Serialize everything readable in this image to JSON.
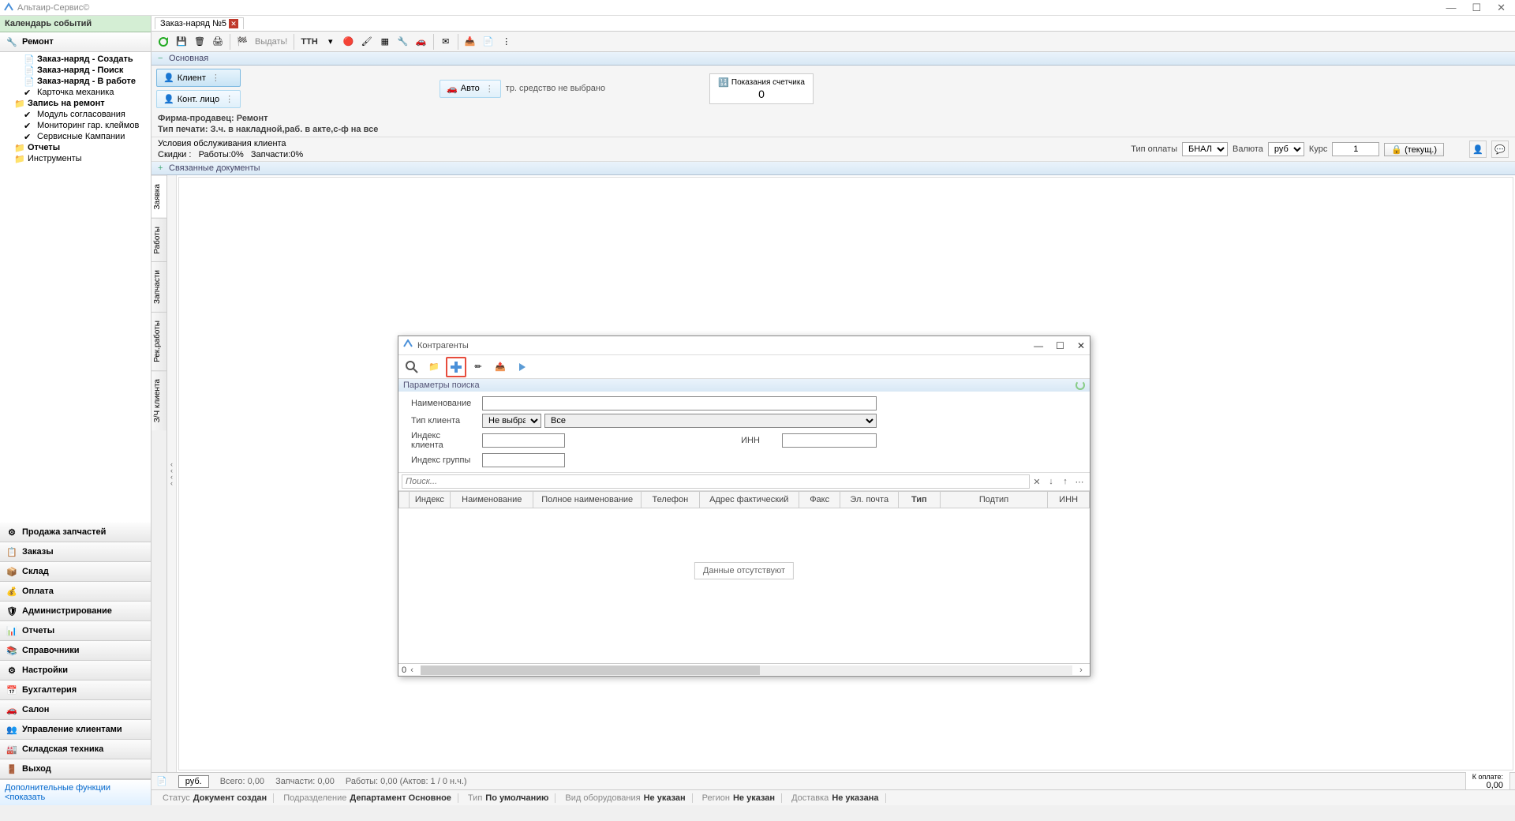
{
  "app": {
    "title": "Альтаир-Сервис©"
  },
  "sidebar": {
    "events_header": "Календарь событий",
    "main_section": "Ремонт",
    "tree": [
      {
        "label": "Заказ-наряд - Создать",
        "bold": true
      },
      {
        "label": "Заказ-наряд - Поиск",
        "bold": true
      },
      {
        "label": "Заказ-наряд - В работе",
        "bold": true
      },
      {
        "label": "Карточка механика",
        "bold": false
      },
      {
        "label": "Запись на ремонт",
        "bold": true,
        "folder": true
      },
      {
        "label": "Модуль согласования",
        "bold": false
      },
      {
        "label": "Мониторинг гар. клеймов",
        "bold": false
      },
      {
        "label": "Сервисные Кампании",
        "bold": false
      },
      {
        "label": "Отчеты",
        "bold": true,
        "folder": true
      },
      {
        "label": "Инструменты",
        "bold": false,
        "folder": true
      }
    ],
    "bottom": [
      "Продажа запчастей",
      "Заказы",
      "Склад",
      "Оплата",
      "Администрирование",
      "Отчеты",
      "Справочники",
      "Настройки",
      "Бухгалтерия",
      "Салон",
      "Управление клиентами",
      "Складская техника",
      "Выход"
    ],
    "footer": "Дополнительные функции <показать"
  },
  "tab": {
    "label": "Заказ-наряд №5"
  },
  "toolbar": {
    "issue": "Выдать!",
    "ttn": "ТТН"
  },
  "main_section": "Основная",
  "buttons": {
    "client": "Клиент",
    "contact": "Конт. лицо",
    "auto": "Авто"
  },
  "vehicle_status": "тр. средство не выбрано",
  "odometer": {
    "label": "Показания счетчика",
    "value": "0"
  },
  "firm": {
    "seller_label": "Фирма-продавец:",
    "seller_value": "Ремонт",
    "print_label": "Тип печати:",
    "print_value": "З.ч. в накладной,раб. в акте,с-ф на все"
  },
  "service": {
    "conditions": "Условия обслуживания клиента",
    "discounts_label": "Скидки :",
    "works_label": "Работы:0%",
    "parts_label": "Запчасти:0%",
    "payment_type_label": "Тип оплаты",
    "payment_type_value": "БНАЛ",
    "currency_label": "Валюта",
    "currency_value": "руб",
    "rate_label": "Курс",
    "rate_value": "1",
    "current_btn": "(текущ.)"
  },
  "linked_docs": "Связанные документы",
  "vtabs": [
    "Заявка",
    "Работы",
    "Запчасти",
    "Рек.работы",
    "З/Ч клиента"
  ],
  "dialog": {
    "title": "Контрагенты",
    "params_header": "Параметры поиска",
    "name_label": "Наименование",
    "client_type_label": "Тип клиента",
    "client_type_value": "Не выбран",
    "client_type_all": "Все",
    "client_index_label": "Индекс клиента",
    "inn_label": "ИНН",
    "group_index_label": "Индекс группы",
    "search_placeholder": "Поиск...",
    "columns": [
      "Индекс",
      "Наименование",
      "Полное наименование",
      "Телефон",
      "Адрес фактический",
      "Факс",
      "Эл. почта",
      "Тип",
      "Подтип",
      "ИНН"
    ],
    "no_data": "Данные отсутствуют",
    "result_count": "0"
  },
  "bottom1": {
    "rub": "руб.",
    "total": "Всего: 0,00",
    "parts": "Запчасти: 0,00",
    "works": "Работы: 0,00 (Актов: 1 / 0 н.ч.)",
    "to_pay_label": "К оплате:",
    "to_pay_value": "0,00"
  },
  "bottom2": {
    "status_label": "Статус",
    "status_value": "Документ создан",
    "division_label": "Подразделение",
    "division_value": "Департамент Основное",
    "type_label": "Тип",
    "type_value": "По умолчанию",
    "equip_label": "Вид оборудования",
    "equip_value": "Не указан",
    "region_label": "Регион",
    "region_value": "Не указан",
    "delivery_label": "Доставка",
    "delivery_value": "Не указана"
  }
}
